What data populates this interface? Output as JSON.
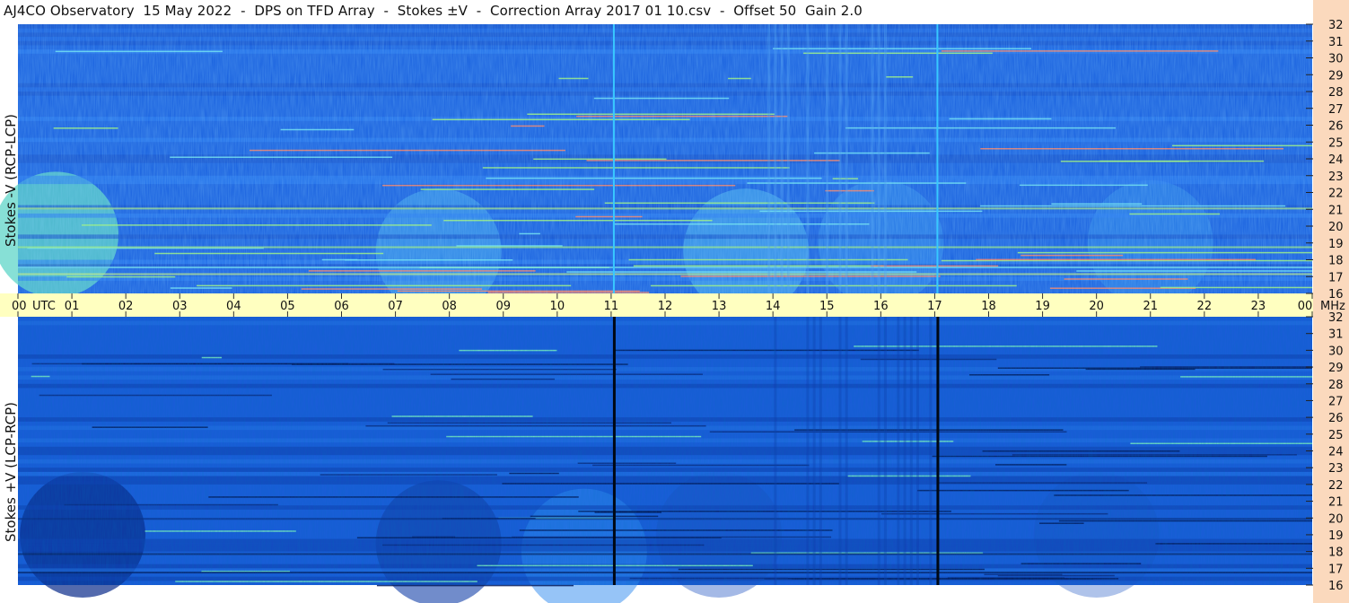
{
  "title": "AJ4CO Observatory  15 May 2022  -  DPS on TFD Array  -  Stokes ±V  -  Correction Array 2017 01 10.csv  -  Offset 50  Gain 2.0",
  "colors": {
    "axis_band": "#ffffc0",
    "right_strip": "#fbd9bd",
    "low": "#0b2a8f",
    "mid": "#1a6ee8",
    "high": "#7cf0a0",
    "hot": "#ff6040"
  },
  "chart_data": [
    {
      "type": "heatmap",
      "name": "top",
      "ylabel": "Stokes -V (RCP-LCP)",
      "yticks": [
        "16",
        "17",
        "18",
        "19",
        "20",
        "21",
        "22",
        "23",
        "24",
        "25",
        "26",
        "27",
        "28",
        "29",
        "30",
        "31",
        "32"
      ],
      "ylim": [
        16,
        32
      ],
      "xlim": [
        0,
        24
      ],
      "vertical_markers": [
        11.05,
        17.05
      ],
      "marker_color": "cyan"
    },
    {
      "type": "heatmap",
      "name": "bottom",
      "ylabel": "Stokes +V (LCP-RCP)",
      "yticks": [
        "16",
        "17",
        "18",
        "19",
        "20",
        "21",
        "22",
        "23",
        "24",
        "25",
        "26",
        "27",
        "28",
        "29",
        "30",
        "31",
        "32"
      ],
      "ylim": [
        16,
        32
      ],
      "xlim": [
        0,
        24
      ],
      "vertical_markers": [
        11.05,
        17.05
      ],
      "marker_color": "black"
    }
  ],
  "xaxis": {
    "ticks": [
      "00",
      "01",
      "02",
      "03",
      "04",
      "05",
      "06",
      "07",
      "08",
      "09",
      "10",
      "11",
      "12",
      "13",
      "14",
      "15",
      "16",
      "17",
      "18",
      "19",
      "20",
      "21",
      "22",
      "23",
      "00"
    ],
    "utc_label": "UTC",
    "unit_label": "MHz"
  }
}
